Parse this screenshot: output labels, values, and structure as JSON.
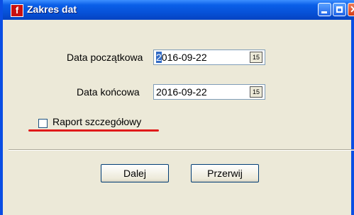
{
  "window": {
    "title": "Zakres dat",
    "app_icon_glyph": "f",
    "title_icon": "app-logo-icon",
    "controls": {
      "minimize": "minimize-icon",
      "maximize": "maximize-icon",
      "close": "close-icon"
    }
  },
  "form": {
    "start_date": {
      "label": "Data początkowa",
      "value": "2016-09-22",
      "calendar_glyph": "15"
    },
    "end_date": {
      "label": "Data końcowa",
      "value": "2016-09-22",
      "calendar_glyph": "15"
    },
    "detailed_report": {
      "label": "Raport szczegółowy",
      "checked": false
    }
  },
  "buttons": {
    "next": "Dalej",
    "cancel": "Przerwij"
  },
  "colors": {
    "titlebar": "#0a5fe8",
    "window_bg": "#ece9d8",
    "highlight_underline": "#e01a1a"
  }
}
